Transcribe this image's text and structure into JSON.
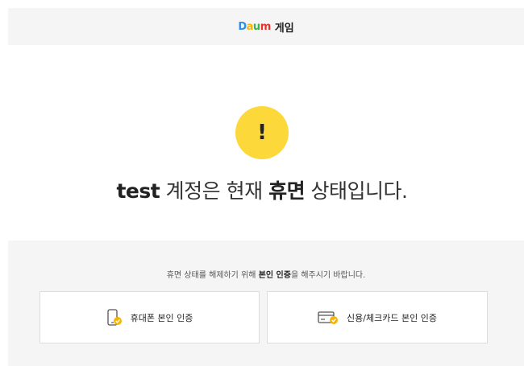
{
  "header": {
    "logo_parts": [
      "D",
      "a",
      "u",
      "m"
    ],
    "logo_sub": "게임"
  },
  "status": {
    "warning_icon": "exclamation-icon",
    "warning_glyph": "!",
    "account": "test",
    "text_a": " 계정은 현재 ",
    "state": "휴면",
    "text_b": " 상태입니다."
  },
  "verify": {
    "notice_a": "휴면 상태를 해제하기 위해 ",
    "notice_strong": "본인 인증",
    "notice_b": "을 해주시기 바랍니다.",
    "phone_label": "휴대폰 본인 인증",
    "card_label": "신용/체크카드 본인 인증"
  },
  "colors": {
    "accent_yellow": "#fcd83a",
    "check_badge": "#f5b500",
    "panel_bg": "#f5f5f5"
  }
}
